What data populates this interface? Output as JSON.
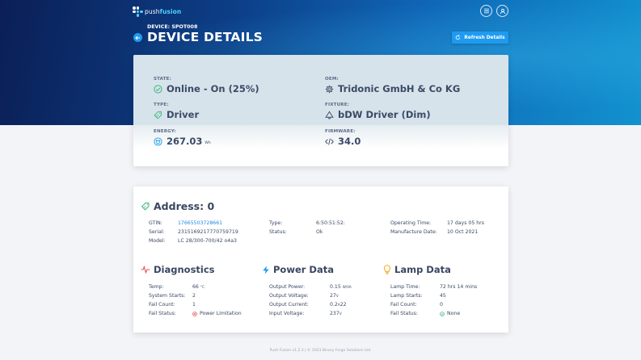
{
  "app": {
    "logo_prefix": "push",
    "logo_suffix": "fusion"
  },
  "header": {
    "device_label": "DEVICE: SPOT008",
    "title": "DEVICE DETAILS",
    "refresh_label": "Refresh Details",
    "menu_icon": "menu-icon",
    "user_icon": "user-icon"
  },
  "summary": {
    "state": {
      "label": "STATE:",
      "value": "Online - On (25%)",
      "icon": "check-circle-icon"
    },
    "oem": {
      "label": "OEM:",
      "value": "Tridonic GmbH & Co KG",
      "icon": "gear-icon"
    },
    "type": {
      "label": "TYPE:",
      "value": "Driver",
      "icon": "tag-icon"
    },
    "fixture": {
      "label": "FIXTURE:",
      "value": "bDW Driver (Dim)",
      "icon": "lamp-icon"
    },
    "energy": {
      "label": "ENERGY:",
      "value": "267.03",
      "unit": "Wh",
      "icon": "plug-icon"
    },
    "firmware": {
      "label": "FIRMWARE:",
      "value": "34.0",
      "icon": "code-icon"
    }
  },
  "address": {
    "title": "Address: 0",
    "gtin_label": "GTIN:",
    "gtin_value": "17665503728661",
    "serial_label": "Serial:",
    "serial_value": "2315169217770759719",
    "model_label": "Model:",
    "model_value": "LC 28/300-700/42 o4a3",
    "type_label": "Type:",
    "type_value": "6:50:51:52:",
    "status_label": "Status:",
    "status_value": "Ok",
    "optime_label": "Operating Time:",
    "optime_value": "17 days 05 hrs",
    "mfg_label": "Manufacture Date:",
    "mfg_value": "10 Oct 2021"
  },
  "diagnostics": {
    "title": "Diagnostics",
    "temp_label": "Temp:",
    "temp_value": "66",
    "temp_unit": "°C",
    "starts_label": "System Starts:",
    "starts_value": "2",
    "failcount_label": "Fail Count:",
    "failcount_value": "1",
    "failstatus_label": "Fail Status:",
    "failstatus_value": "Power Limitation"
  },
  "power": {
    "title": "Power Data",
    "output_power_label": "Output Power:",
    "output_power_value": "0.15",
    "output_power_unit": "W/VA",
    "output_voltage_label": "Output Voltage:",
    "output_voltage_value": "27",
    "output_voltage_unit": "V",
    "output_current_label": "Output Current:",
    "output_current_value": "0.2",
    "output_current_unit": "A",
    "output_current_extra": "22",
    "input_voltage_label": "Input Voltage:",
    "input_voltage_value": "237",
    "input_voltage_unit": "V"
  },
  "lamp": {
    "title": "Lamp Data",
    "time_label": "Lamp Time:",
    "time_value": "72 hrs 14 mins",
    "starts_label": "Lamp Starts:",
    "starts_value": "45",
    "failcount_label": "Fail Count:",
    "failcount_value": "0",
    "failstatus_label": "Fail Status:",
    "failstatus_value": "None"
  },
  "footer": {
    "text": "Push Fusion v1.2.3 | © 2023 Binary Forge Solutions Ltd."
  },
  "colors": {
    "accent": "#1e9bf0",
    "hero_dark": "#0b1f56",
    "hero_light": "#1292cf",
    "ok_green": "#3cb878",
    "error_red": "#e05252",
    "lamp_orange": "#f5a623"
  }
}
